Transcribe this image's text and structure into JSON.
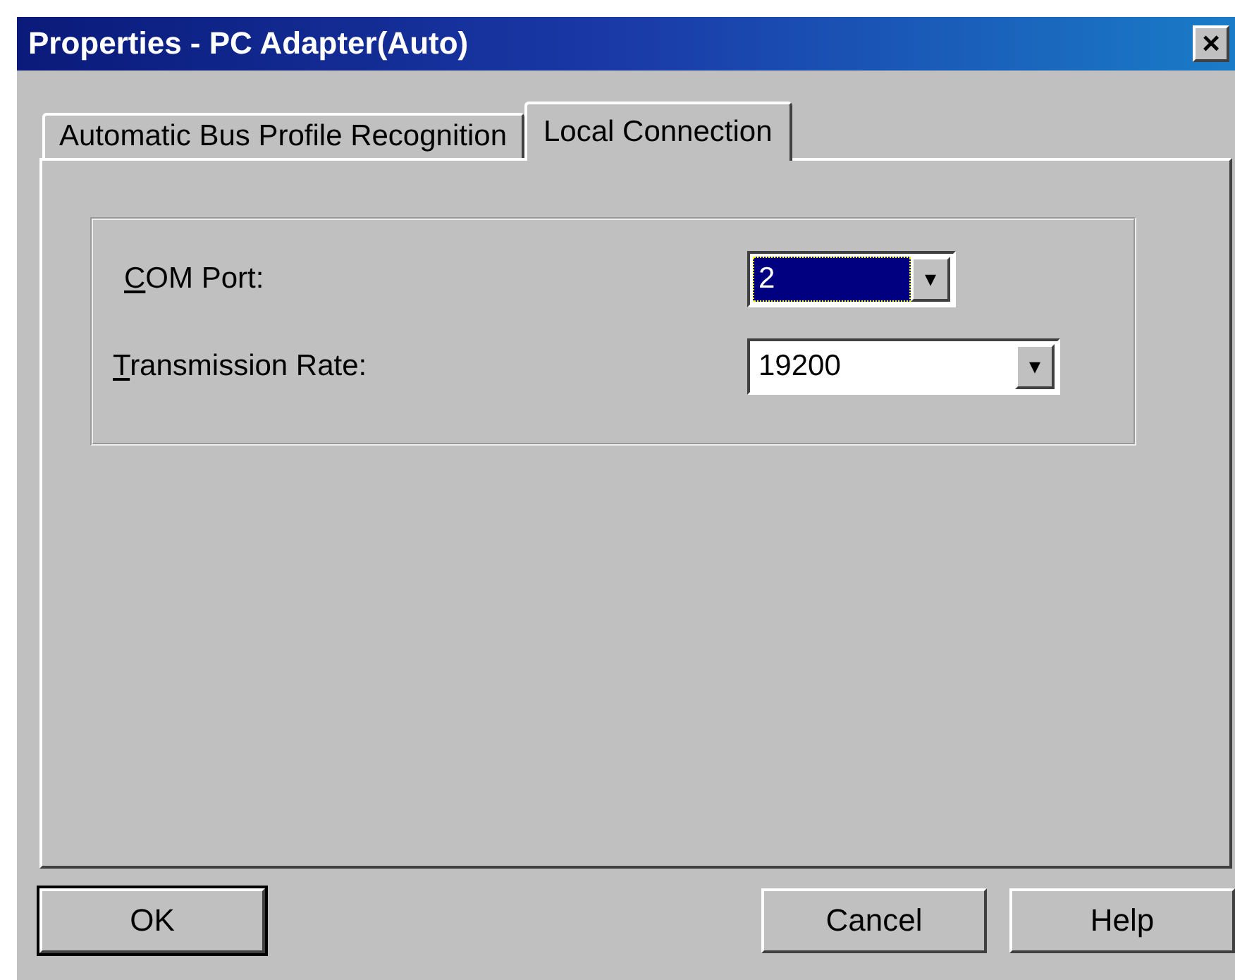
{
  "window": {
    "title": "Properties - PC Adapter(Auto)",
    "close": "×"
  },
  "tabs": [
    {
      "label": "Automatic Bus Profile Recognition",
      "selected": false
    },
    {
      "label": "Local Connection",
      "selected": true
    }
  ],
  "fields": [
    {
      "label": "COM Port:",
      "underline_first": true,
      "value": "2",
      "arrow": "▾",
      "focused": true
    },
    {
      "label": "Transmission Rate:",
      "underline_first": true,
      "value": "19200",
      "arrow": "▾",
      "focused": false
    }
  ],
  "buttons": [
    {
      "label": "OK",
      "default": true
    },
    {
      "label": "Cancel",
      "default": false
    },
    {
      "label": "Help",
      "default": false
    }
  ]
}
